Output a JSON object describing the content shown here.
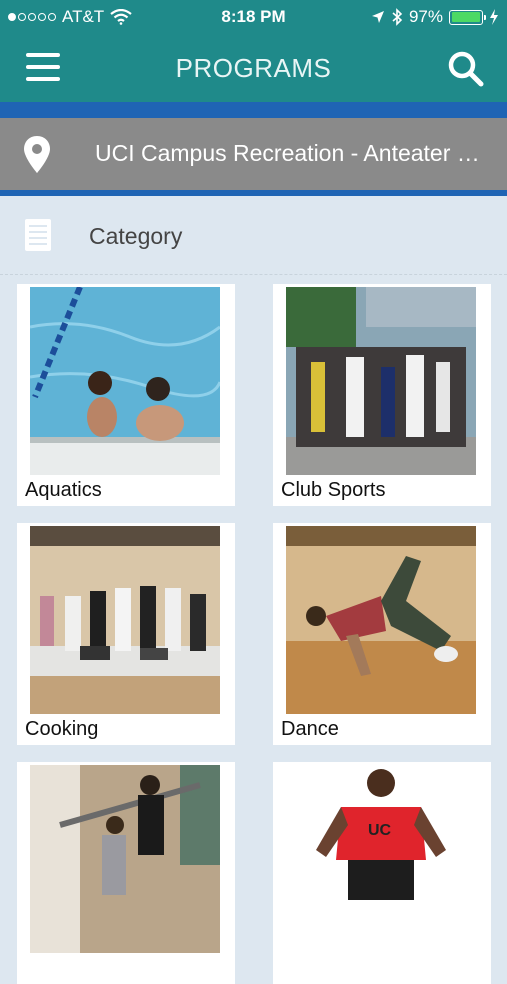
{
  "status_bar": {
    "carrier": "AT&T",
    "time": "8:18 PM",
    "battery": "97%",
    "signal_bars": 1,
    "battery_level": 0.97
  },
  "nav": {
    "title": "PROGRAMS",
    "menu_icon": "hamburger-menu-icon",
    "search_icon": "search-icon"
  },
  "location": {
    "text": "UCI Campus Recreation - Anteater R…",
    "icon": "location-pin-icon"
  },
  "category": {
    "label": "Category",
    "icon": "category-list-icon"
  },
  "programs": [
    {
      "label": "Aquatics"
    },
    {
      "label": "Club Sports"
    },
    {
      "label": "Cooking"
    },
    {
      "label": "Dance"
    },
    {
      "label": ""
    },
    {
      "label": ""
    }
  ],
  "colors": {
    "nav_bg": "#1f8a8a",
    "stripe": "#1f64b4",
    "location_bg": "#8a8a8a",
    "page_bg": "#dde7f0"
  }
}
